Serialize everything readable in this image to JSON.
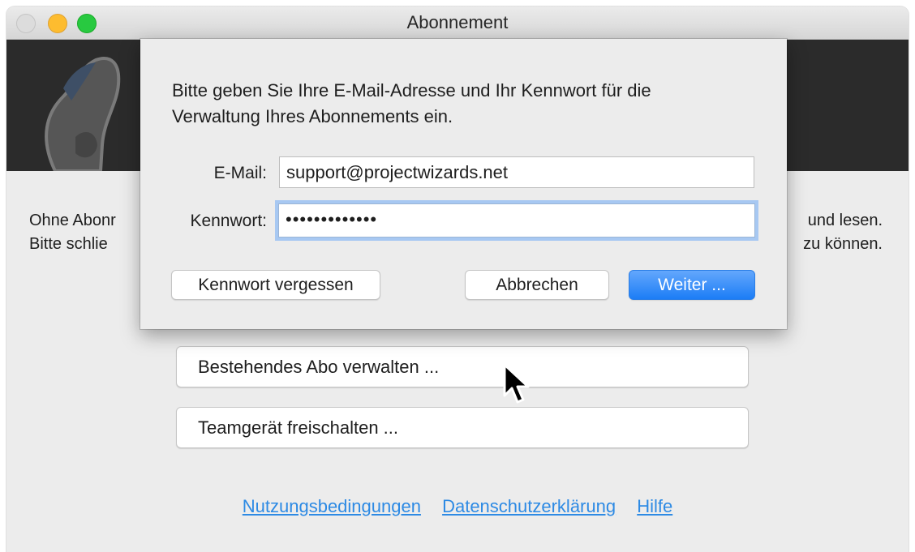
{
  "window": {
    "title": "Abonnement"
  },
  "main": {
    "intro_left_1": "Ohne Abonr",
    "intro_left_2": "Bitte schlie",
    "intro_right_1": "und lesen.",
    "intro_right_2": "zu können.",
    "manage_button": "Bestehendes Abo verwalten ...",
    "unlock_button": "Teamgerät freischalten ...",
    "links": [
      "Nutzungsbedingungen",
      "Datenschutzerklärung",
      "Hilfe"
    ]
  },
  "sheet": {
    "message_line1": "Bitte geben Sie Ihre E-Mail-Adresse und Ihr Kennwort für die",
    "message_line2": "Verwaltung Ihres Abonnements ein.",
    "email_label": "E-Mail:",
    "email_value": "support@projectwizards.net",
    "password_label": "Kennwort:",
    "password_value": "•••••••••••••",
    "forgot_button": "Kennwort vergessen",
    "cancel_button": "Abbrechen",
    "continue_button": "Weiter ..."
  },
  "colors": {
    "accent": "#1c7df6",
    "link": "#2d8ae4",
    "banner": "#2b2b2b"
  }
}
